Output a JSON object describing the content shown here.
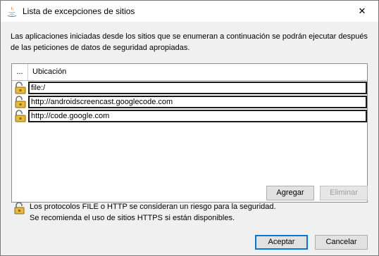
{
  "window": {
    "title": "Lista de excepciones de sitios",
    "close_glyph": "✕"
  },
  "description": "Las aplicaciones iniciadas desde los sitios que se enumeran a continuación se podrán ejecutar después de las peticiones de datos de seguridad apropiadas.",
  "table": {
    "columns": [
      "...",
      "Ubicación"
    ],
    "rows": [
      {
        "location": "file:/",
        "icon": "lock-icon"
      },
      {
        "location": "http://androidscreencast.googlecode.com",
        "icon": "lock-icon"
      },
      {
        "location": "http://code.google.com",
        "icon": "lock-icon"
      }
    ]
  },
  "buttons": {
    "add": "Agregar",
    "remove": "Eliminar",
    "accept": "Aceptar",
    "cancel": "Cancelar"
  },
  "warning": {
    "line1": "Los protocolos FILE o HTTP se consideran un riesgo para la seguridad.",
    "line2": "Se recomienda el uso de sitios HTTPS si están disponibles.",
    "icon": "lock-icon"
  },
  "colors": {
    "accent": "#0078d7",
    "lock_gold": "#e8b93a",
    "background": "#f0f0f0"
  }
}
